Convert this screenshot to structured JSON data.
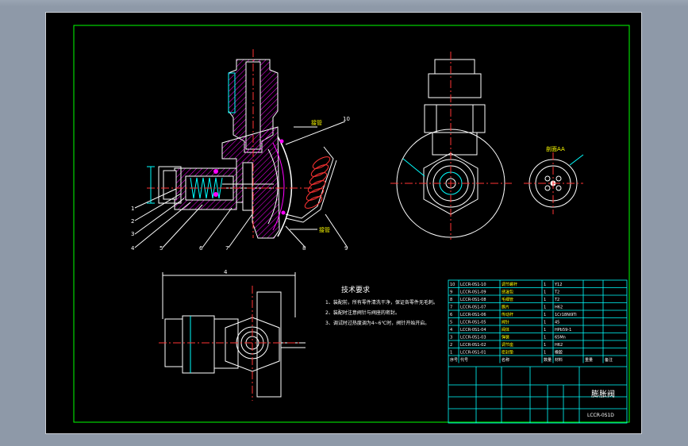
{
  "title_block": {
    "part_name": "膨胀阀",
    "drawing_no": "LCCR-0S1D"
  },
  "tech_requirements": {
    "heading": "技术要求",
    "items": [
      "1、装配前，所有零件清洗干净，保证各零件无毛刺。",
      "2、装配时注意阀针与阀座的密封。",
      "3、调试时过热度调为4~6℃时，阀针开始开启。"
    ]
  },
  "bom": {
    "headers": [
      "序号",
      "代号",
      "名称",
      "数量",
      "材料",
      "重量",
      "备注"
    ],
    "rows": [
      [
        "10",
        "LCCR-0S1-10",
        "调节螺杆",
        "1",
        "Y12",
        ""
      ],
      [
        "9",
        "LCCR-0S1-09",
        "感温包",
        "1",
        "T2"
      ],
      [
        "8",
        "LCCR-0S1-08",
        "毛细管",
        "1",
        "T2"
      ],
      [
        "7",
        "LCCR-0S1-07",
        "膜片",
        "1",
        "H62"
      ],
      [
        "6",
        "LCCR-0S1-06",
        "传动杆",
        "1",
        "1Cr18Ni9Ti"
      ],
      [
        "5",
        "LCCR-0S1-05",
        "阀针",
        "1",
        "45"
      ],
      [
        "4",
        "LCCR-0S1-04",
        "阀体",
        "1",
        "HPb59-1"
      ],
      [
        "3",
        "LCCR-0S1-03",
        "弹簧",
        "1",
        "65Mn"
      ],
      [
        "2",
        "LCCR-0S1-02",
        "调节座",
        "1",
        "H62"
      ],
      [
        "1",
        "LCCR-0S1-01",
        "密封垫",
        "1",
        "橡胶"
      ]
    ]
  },
  "labels": {
    "callouts": [
      "1",
      "2",
      "3",
      "4",
      "5",
      "6",
      "7",
      "8",
      "9",
      "10"
    ],
    "inlet": "接管",
    "outlet": "接管",
    "section": "剖面AA",
    "dim_width": "4"
  },
  "colors": {
    "frame": "#00ff00",
    "outline": "#ffffff",
    "hatch": "#ff00ff",
    "center": "#ff3333",
    "dim": "#00ffff",
    "annotation": "#ffff00"
  }
}
